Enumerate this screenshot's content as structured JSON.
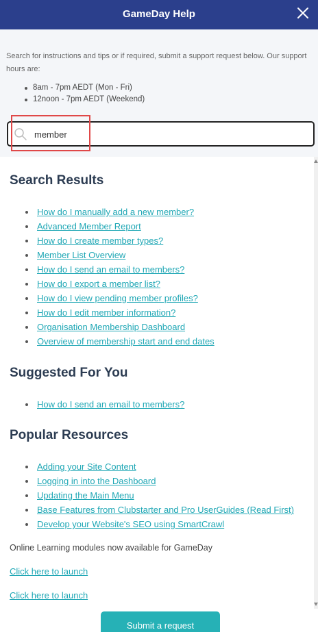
{
  "header": {
    "title": "GameDay Help",
    "close_icon": "close-icon"
  },
  "intro": {
    "text": "Search for instructions and tips or if required, submit a support request below. Our support hours are:",
    "hours": [
      "8am - 7pm AEDT (Mon - Fri)",
      "12noon - 7pm AEDT (Weekend)"
    ]
  },
  "search": {
    "value": "member",
    "icon": "search-icon"
  },
  "search_results": {
    "title": "Search Results",
    "links": [
      "How do I manually add a new member?",
      "Advanced Member Report",
      "How do I create member types?",
      "Member List Overview",
      "How do I send an email to members?",
      "How do I export a member list?",
      "How do I view pending member profiles?",
      "How do I edit member information?",
      "Organisation Membership Dashboard",
      "Overview of membership start and end dates"
    ]
  },
  "suggested": {
    "title": "Suggested For You",
    "links": [
      "How do I send an email to members?"
    ]
  },
  "popular": {
    "title": "Popular Resources",
    "links": [
      "Adding your Site Content",
      "Logging in into the Dashboard",
      "Updating the Main Menu",
      "Base Features from Clubstarter and Pro UserGuides (Read First)",
      "Develop your Website's SEO using SmartCrawl"
    ]
  },
  "online_learning": {
    "text": "Online Learning modules now available for GameDay",
    "launch_links": [
      "Click here to launch",
      "Click here to launch"
    ]
  },
  "submit": {
    "label": "Submit a request"
  },
  "colors": {
    "header": "#2b3f8c",
    "link": "#1fa7b5",
    "button": "#26b1b6",
    "highlight": "#e04848"
  }
}
